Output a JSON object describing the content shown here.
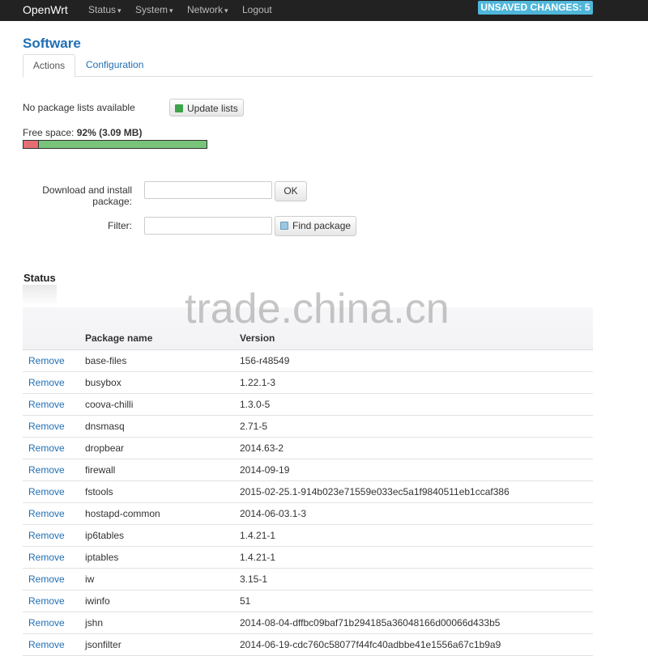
{
  "nav": {
    "brand": "OpenWrt",
    "menu": [
      "Status",
      "System",
      "Network"
    ],
    "logout": "Logout",
    "unsaved": "UNSAVED CHANGES: 5"
  },
  "page": {
    "title": "Software"
  },
  "tabs": {
    "actions": "Actions",
    "configuration": "Configuration"
  },
  "lists": {
    "message": "No package lists available",
    "update_button": "Update lists"
  },
  "space": {
    "label": "Free space:",
    "value": "92%",
    "size": "(3.09 MB)",
    "used_fraction": 0.08
  },
  "form": {
    "download_label_1": "Download and install",
    "download_label_2": "package:",
    "ok_button": "OK",
    "filter_label": "Filter:",
    "find_button": "Find package",
    "download_value": "",
    "filter_value": ""
  },
  "status": {
    "title": "Status",
    "watermark": "trade.china.cn",
    "headers": {
      "name": "Package name",
      "version": "Version"
    },
    "action_label": "Remove",
    "packages": [
      {
        "name": "base-files",
        "version": "156-r48549"
      },
      {
        "name": "busybox",
        "version": "1.22.1-3"
      },
      {
        "name": "coova-chilli",
        "version": "1.3.0-5"
      },
      {
        "name": "dnsmasq",
        "version": "2.71-5"
      },
      {
        "name": "dropbear",
        "version": "2014.63-2"
      },
      {
        "name": "firewall",
        "version": "2014-09-19"
      },
      {
        "name": "fstools",
        "version": "2015-02-25.1-914b023e71559e033ec5a1f9840511eb1ccaf386"
      },
      {
        "name": "hostapd-common",
        "version": "2014-06-03.1-3"
      },
      {
        "name": "ip6tables",
        "version": "1.4.21-1"
      },
      {
        "name": "iptables",
        "version": "1.4.21-1"
      },
      {
        "name": "iw",
        "version": "3.15-1"
      },
      {
        "name": "iwinfo",
        "version": "51"
      },
      {
        "name": "jshn",
        "version": "2014-08-04-dffbc09baf71b294185a36048166d00066d433b5"
      },
      {
        "name": "jsonfilter",
        "version": "2014-06-19-cdc760c58077f44fc40adbbe41e1556a67c1b9a9"
      }
    ]
  }
}
